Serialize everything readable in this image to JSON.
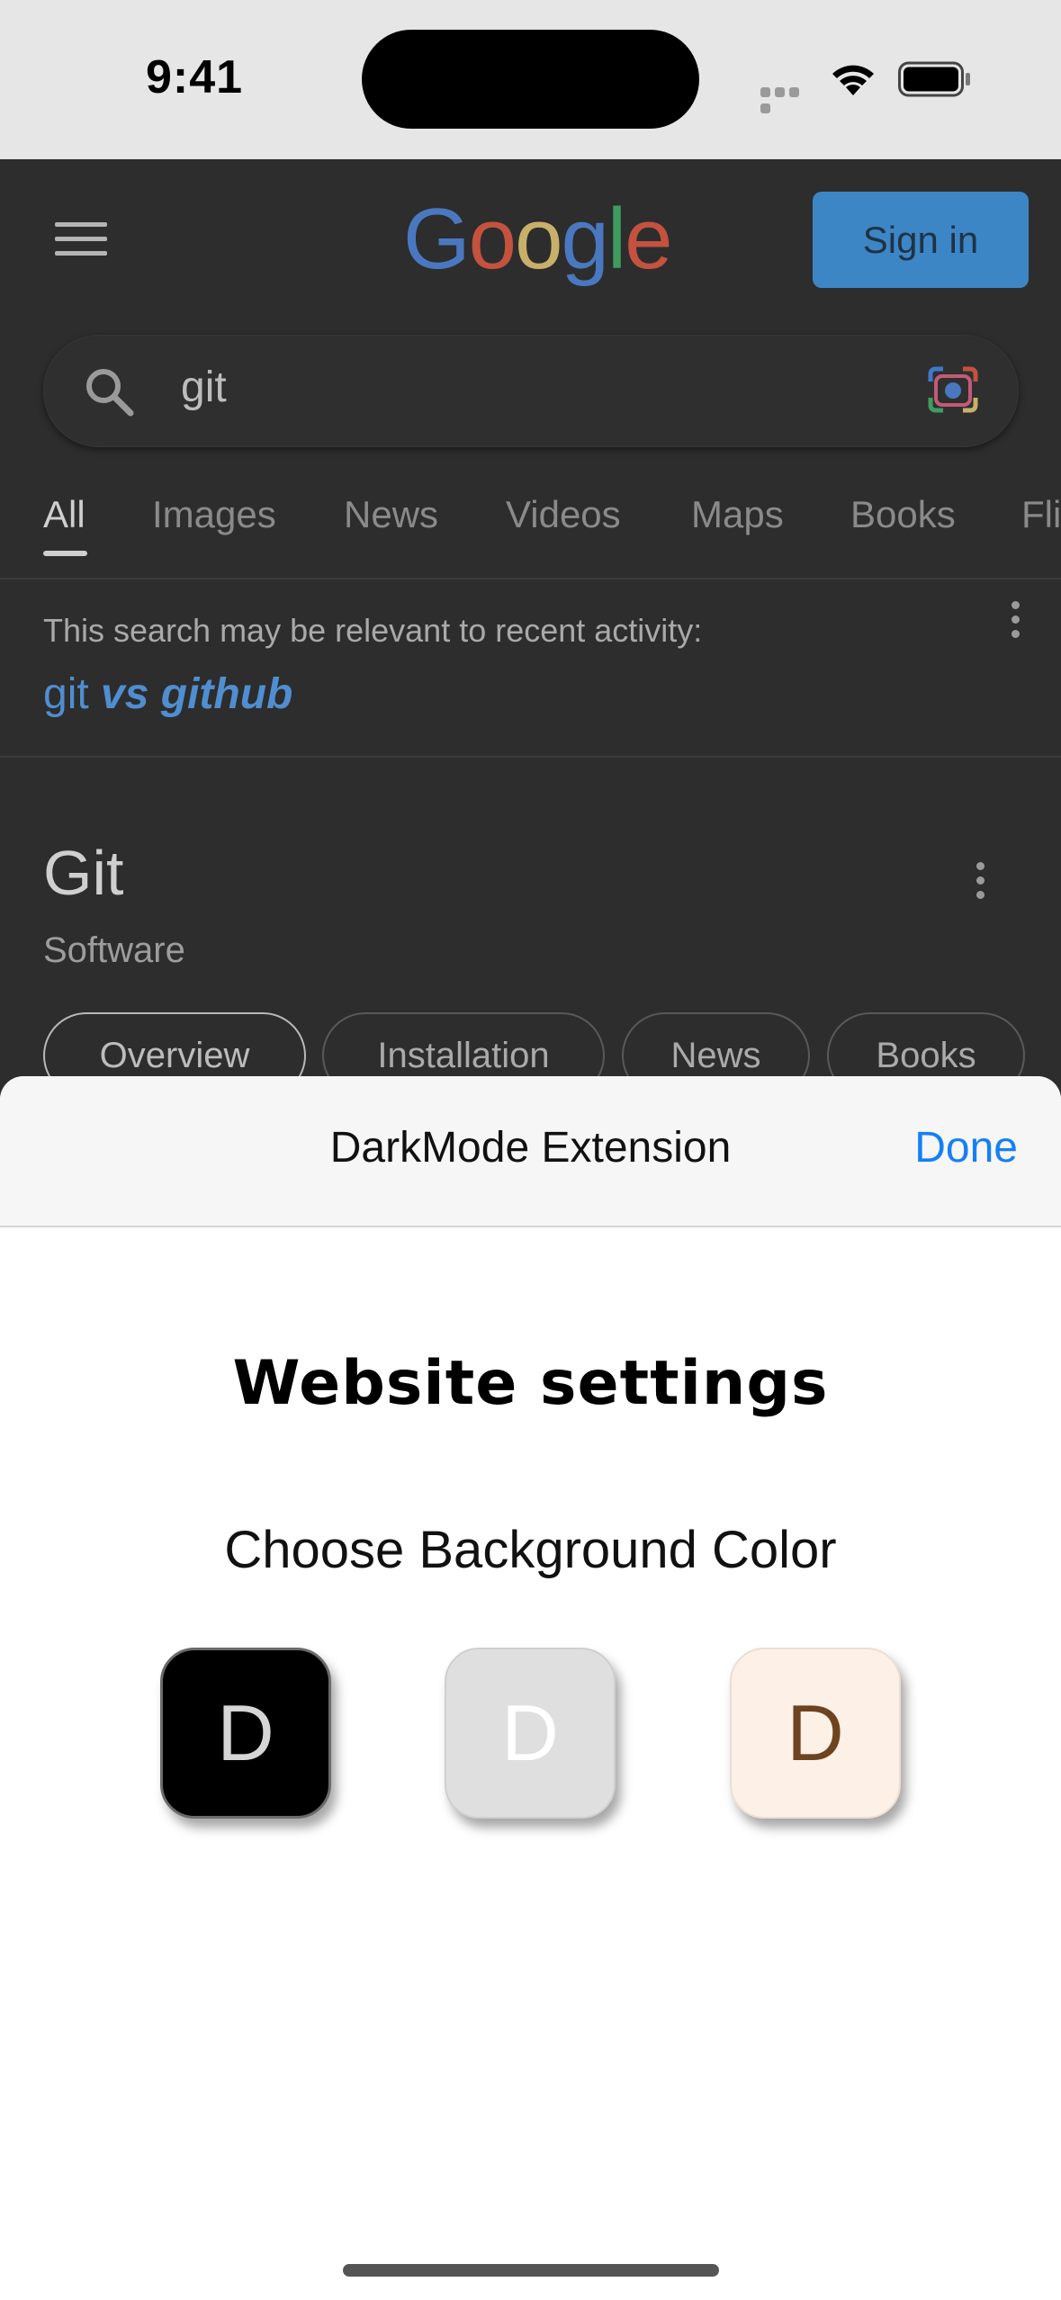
{
  "status_bar": {
    "time": "9:41"
  },
  "google": {
    "logo_letters": [
      {
        "char": "G",
        "color": "#4a78c0"
      },
      {
        "char": "o",
        "color": "#c4523f"
      },
      {
        "char": "o",
        "color": "#c8b06a"
      },
      {
        "char": "g",
        "color": "#4a78c0"
      },
      {
        "char": "l",
        "color": "#3f9c60"
      },
      {
        "char": "e",
        "color": "#c4523f"
      }
    ],
    "signin_label": "Sign in"
  },
  "search": {
    "query": "git"
  },
  "tabs": [
    {
      "label": "All",
      "active": true
    },
    {
      "label": "Images"
    },
    {
      "label": "News"
    },
    {
      "label": "Videos"
    },
    {
      "label": "Maps"
    },
    {
      "label": "Books"
    },
    {
      "label": "Fli"
    }
  ],
  "recent": {
    "caption": "This search may be relevant to recent activity:",
    "link_plain": "git",
    "link_bold": "vs github"
  },
  "knowledge_panel": {
    "title": "Git",
    "subtitle": "Software",
    "chips": [
      "Overview",
      "Installation",
      "News",
      "Books"
    ]
  },
  "sheet": {
    "header_title": "DarkMode Extension",
    "done_label": "Done",
    "settings_title": "Website settings",
    "bg_label": "Choose Background Color",
    "swatches": [
      {
        "letter": "D",
        "background": "#000000"
      },
      {
        "letter": "D",
        "background": "#dfdfdf"
      },
      {
        "letter": "D",
        "background": "#fdf1e7"
      }
    ]
  }
}
